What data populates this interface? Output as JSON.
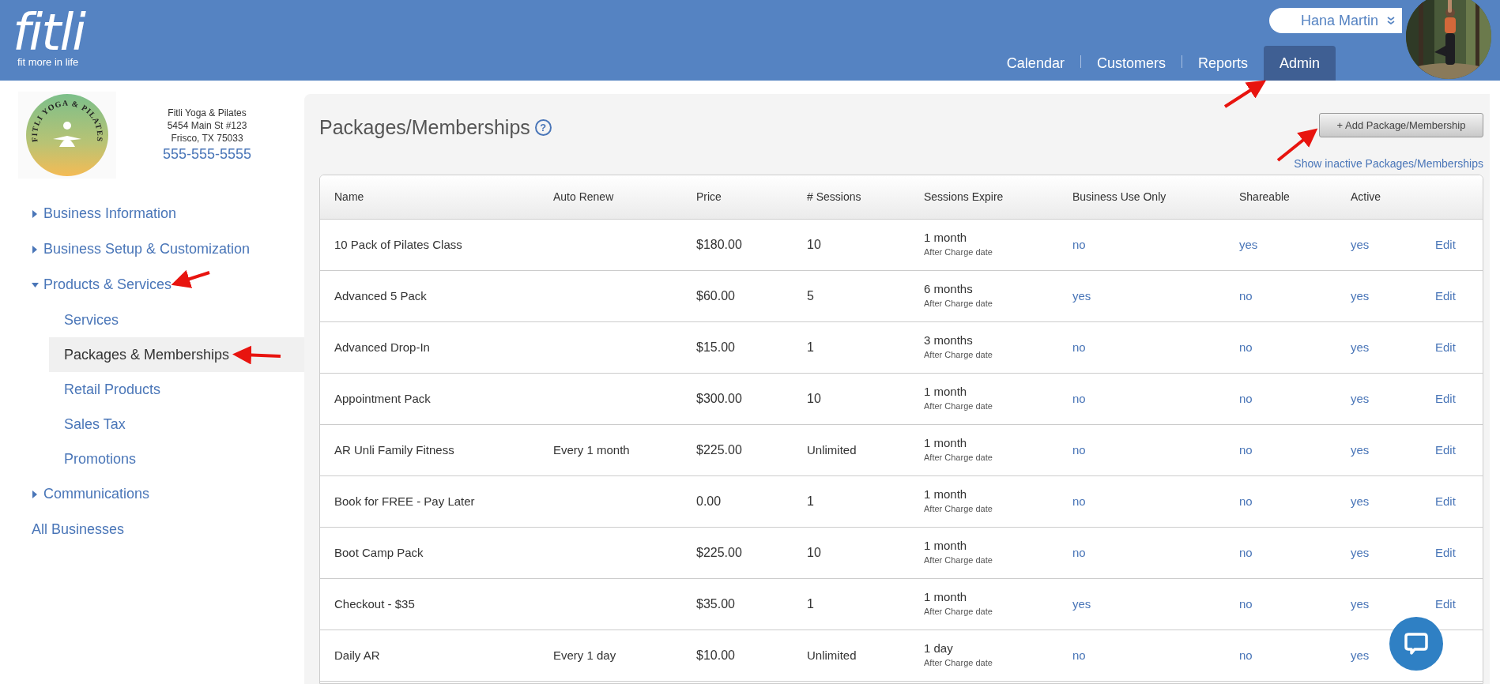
{
  "header": {
    "logo": "fitli",
    "tagline": "fit more in life",
    "user": "Hana Martin",
    "nav": [
      {
        "label": "Calendar",
        "selected": false
      },
      {
        "label": "Customers",
        "selected": false
      },
      {
        "label": "Reports",
        "selected": false
      },
      {
        "label": "Admin",
        "selected": true
      }
    ]
  },
  "business": {
    "logo_text": "FITLI YOGA & PILATES",
    "name": "Fitli Yoga & Pilates",
    "address": "5454 Main St #123",
    "city": "Frisco, TX 75033",
    "phone": "555-555-5555"
  },
  "sidebar": {
    "items": [
      {
        "label": "Business Information",
        "kind": "section",
        "expanded": false
      },
      {
        "label": "Business Setup & Customization",
        "kind": "section",
        "expanded": false
      },
      {
        "label": "Products & Services",
        "kind": "section",
        "expanded": true,
        "children": [
          {
            "label": "Services",
            "selected": false
          },
          {
            "label": "Packages & Memberships",
            "selected": true
          },
          {
            "label": "Retail Products",
            "selected": false
          },
          {
            "label": "Sales Tax",
            "selected": false
          },
          {
            "label": "Promotions",
            "selected": false
          }
        ]
      },
      {
        "label": "Communications",
        "kind": "section",
        "expanded": false
      },
      {
        "label": "All Businesses",
        "kind": "link"
      }
    ]
  },
  "page": {
    "title": "Packages/Memberships",
    "help": "?",
    "add_button": "+ Add Package/Membership",
    "inactive_link": "Show inactive Packages/Memberships"
  },
  "table": {
    "columns": [
      "Name",
      "Auto Renew",
      "Price",
      "# Sessions",
      "Sessions Expire",
      "Business Use Only",
      "Shareable",
      "Active"
    ],
    "rows": [
      {
        "name": "10 Pack of Pilates Class",
        "auto_renew": "",
        "price": "$180.00",
        "sessions": "10",
        "expire": "1 month",
        "expire_note": "After Charge date",
        "business_use_only": "no",
        "shareable": "yes",
        "active": "yes",
        "action": "Edit"
      },
      {
        "name": "Advanced 5 Pack",
        "auto_renew": "",
        "price": "$60.00",
        "sessions": "5",
        "expire": "6 months",
        "expire_note": "After Charge date",
        "business_use_only": "yes",
        "shareable": "no",
        "active": "yes",
        "action": "Edit"
      },
      {
        "name": "Advanced Drop-In",
        "auto_renew": "",
        "price": "$15.00",
        "sessions": "1",
        "expire": "3 months",
        "expire_note": "After Charge date",
        "business_use_only": "no",
        "shareable": "no",
        "active": "yes",
        "action": "Edit"
      },
      {
        "name": "Appointment Pack",
        "auto_renew": "",
        "price": "$300.00",
        "sessions": "10",
        "expire": "1 month",
        "expire_note": "After Charge date",
        "business_use_only": "no",
        "shareable": "no",
        "active": "yes",
        "action": "Edit"
      },
      {
        "name": "AR Unli Family Fitness",
        "auto_renew": "Every 1 month",
        "price": "$225.00",
        "sessions": "Unlimited",
        "expire": "1 month",
        "expire_note": "After Charge date",
        "business_use_only": "no",
        "shareable": "no",
        "active": "yes",
        "action": "Edit"
      },
      {
        "name": "Book for FREE - Pay Later",
        "auto_renew": "",
        "price": "0.00",
        "sessions": "1",
        "expire": "1 month",
        "expire_note": "After Charge date",
        "business_use_only": "no",
        "shareable": "no",
        "active": "yes",
        "action": "Edit"
      },
      {
        "name": "Boot Camp Pack",
        "auto_renew": "",
        "price": "$225.00",
        "sessions": "10",
        "expire": "1 month",
        "expire_note": "After Charge date",
        "business_use_only": "no",
        "shareable": "no",
        "active": "yes",
        "action": "Edit"
      },
      {
        "name": "Checkout - $35",
        "auto_renew": "",
        "price": "$35.00",
        "sessions": "1",
        "expire": "1 month",
        "expire_note": "After Charge date",
        "business_use_only": "yes",
        "shareable": "no",
        "active": "yes",
        "action": "Edit"
      },
      {
        "name": "Daily AR",
        "auto_renew": "Every 1 day",
        "price": "$10.00",
        "sessions": "Unlimited",
        "expire": "1 day",
        "expire_note": "After Charge date",
        "business_use_only": "no",
        "shareable": "no",
        "active": "yes"
      }
    ]
  }
}
